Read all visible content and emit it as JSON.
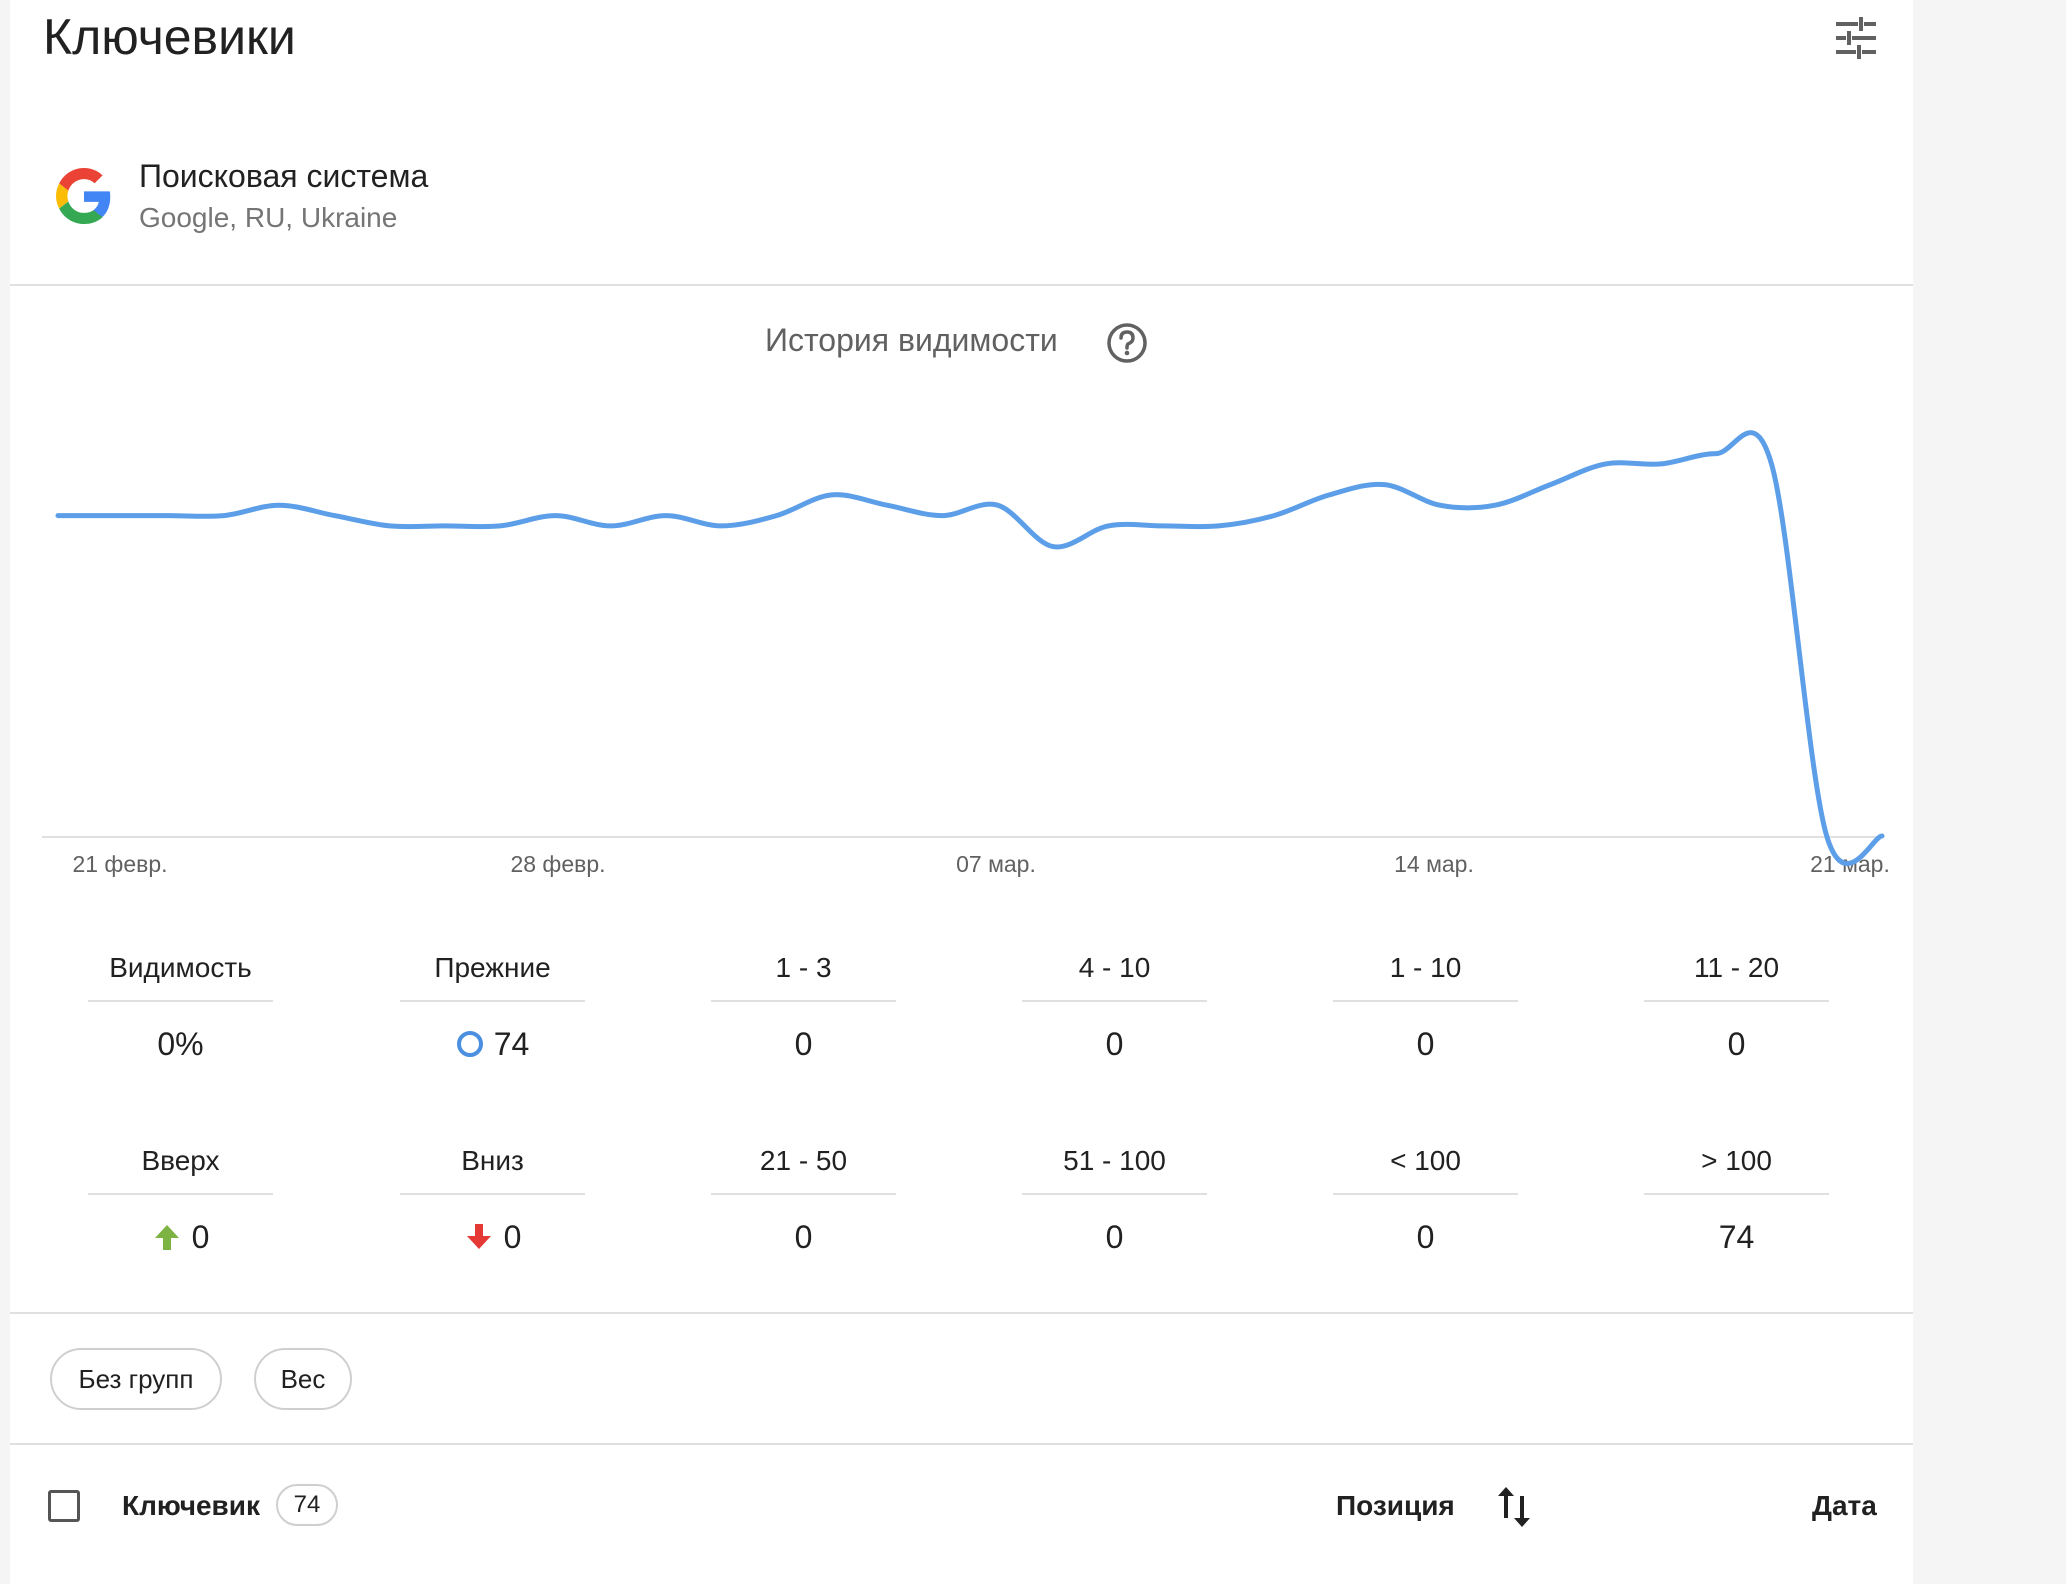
{
  "page": {
    "title": "Ключевики"
  },
  "engine": {
    "name": "Поисковая система",
    "details": "Google, RU, Ukraine"
  },
  "chart": {
    "title": "История видимости",
    "x_ticks": [
      "21 февр.",
      "28 февр.",
      "07 мар.",
      "14 мар.",
      "21 мар."
    ],
    "line_color": "#5c9ee8"
  },
  "chart_data": {
    "type": "line",
    "x": [
      "21 февр.",
      "22 февр.",
      "23 февр.",
      "24 февр.",
      "25 февр.",
      "26 февр.",
      "27 февр.",
      "28 февр.",
      "01 мар.",
      "02 мар.",
      "03 мар.",
      "04 мар.",
      "05 мар.",
      "06 мар.",
      "07 мар.",
      "08 мар.",
      "09 мар.",
      "10 мар.",
      "11 мар.",
      "12 мар.",
      "13 мар.",
      "14 мар.",
      "15 мар.",
      "16 мар.",
      "17 мар.",
      "18 мар.",
      "19 мар.",
      "20 мар.",
      "21 мар."
    ],
    "series": [
      {
        "values": [
          31,
          31,
          31,
          31,
          32,
          31,
          30,
          30,
          30,
          31,
          30,
          31,
          30,
          31,
          33,
          32,
          31,
          32,
          28,
          30,
          30,
          30,
          31,
          33,
          34,
          32,
          32,
          34,
          36,
          36,
          37,
          36,
          0,
          0
        ]
      }
    ],
    "x_tick_labels": [
      "21 февр.",
      "28 февр.",
      "07 мар.",
      "14 мар.",
      "21 мар."
    ]
  },
  "stats_row1": [
    {
      "label": "Видимость",
      "value": "0%",
      "icon": ""
    },
    {
      "label": "Прежние",
      "value": "74",
      "icon": "circle"
    },
    {
      "label": "1 - 3",
      "value": "0",
      "icon": ""
    },
    {
      "label": "4 - 10",
      "value": "0",
      "icon": ""
    },
    {
      "label": "1 - 10",
      "value": "0",
      "icon": ""
    },
    {
      "label": "11 - 20",
      "value": "0",
      "icon": ""
    }
  ],
  "stats_row2": [
    {
      "label": "Вверх",
      "value": "0",
      "icon": "arrow-up"
    },
    {
      "label": "Вниз",
      "value": "0",
      "icon": "arrow-down"
    },
    {
      "label": "21 - 50",
      "value": "0",
      "icon": ""
    },
    {
      "label": "51 - 100",
      "value": "0",
      "icon": ""
    },
    {
      "label": "< 100",
      "value": "0",
      "icon": ""
    },
    {
      "label": "> 100",
      "value": "74",
      "icon": ""
    }
  ],
  "chips": {
    "no_groups": "Без групп",
    "weight": "Вес"
  },
  "table": {
    "keyword_header": "Ключевик",
    "keyword_count": "74",
    "position_header": "Позиция",
    "date_header": "Дата"
  },
  "colors": {
    "up": "#7cb342",
    "down": "#e53935",
    "circle": "#4a8fe0"
  }
}
